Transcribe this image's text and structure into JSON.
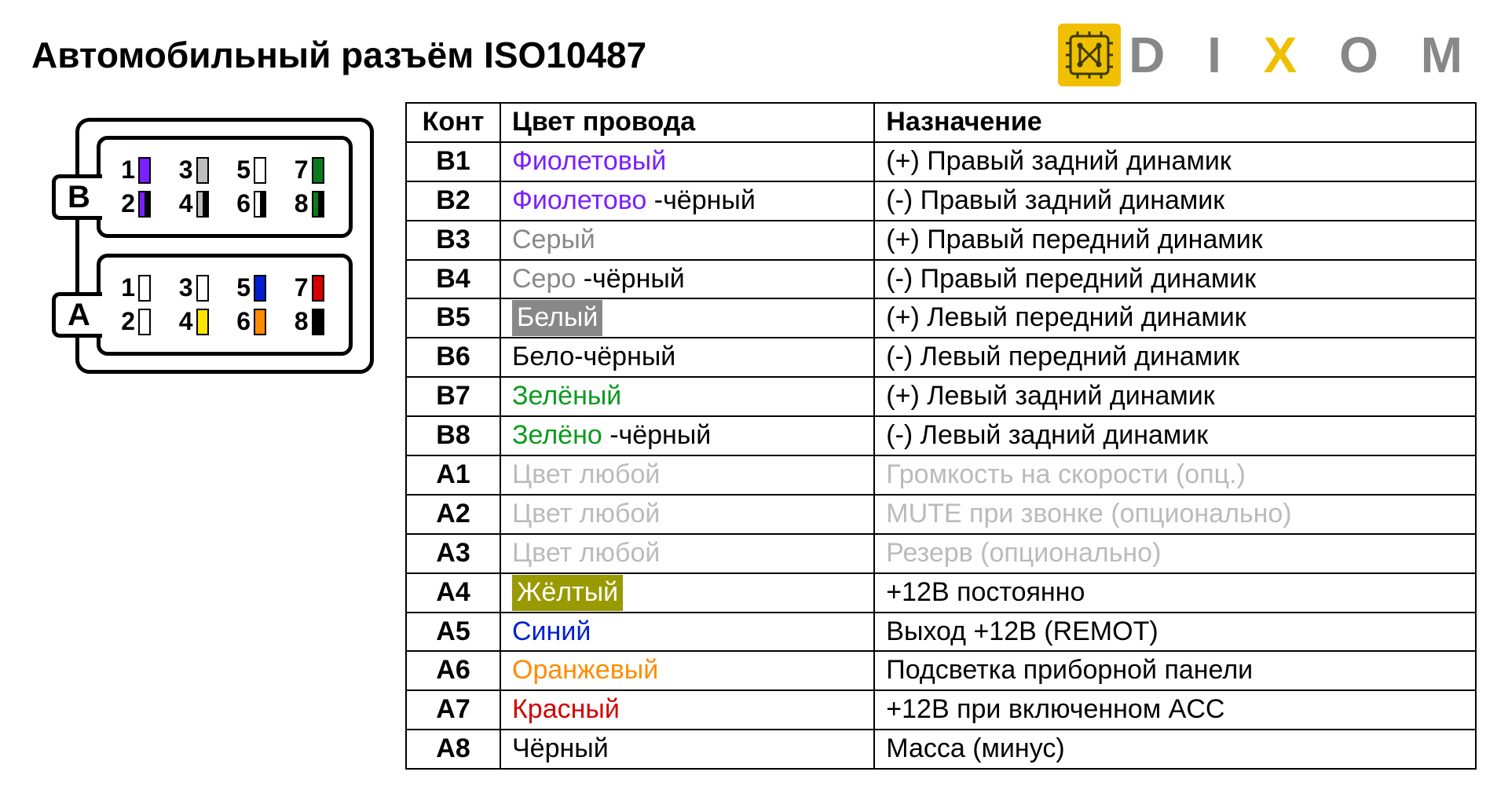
{
  "title": "Автомобильный разъём ISO10487",
  "brand": "DIXOM",
  "columns": {
    "pin": "Конт",
    "color": "Цвет провода",
    "function": "Назначение"
  },
  "connector": {
    "blocks": [
      {
        "name": "B",
        "rows": [
          [
            {
              "n": "1",
              "fill": "#7a1fff",
              "stripe": false
            },
            {
              "n": "3",
              "fill": "#bdbdbd",
              "stripe": false
            },
            {
              "n": "5",
              "fill": "#ffffff",
              "stripe": false
            },
            {
              "n": "7",
              "fill": "#0b7a1f",
              "stripe": false
            }
          ],
          [
            {
              "n": "2",
              "fill": "#7a1fff",
              "stripe": true
            },
            {
              "n": "4",
              "fill": "#bdbdbd",
              "stripe": true
            },
            {
              "n": "6",
              "fill": "#ffffff",
              "stripe": true
            },
            {
              "n": "8",
              "fill": "#0b7a1f",
              "stripe": true
            }
          ]
        ]
      },
      {
        "name": "A",
        "rows": [
          [
            {
              "n": "1",
              "fill": "#ffffff",
              "stripe": false
            },
            {
              "n": "3",
              "fill": "#ffffff",
              "stripe": false
            },
            {
              "n": "5",
              "fill": "#0020d0",
              "stripe": false
            },
            {
              "n": "7",
              "fill": "#d40000",
              "stripe": false
            }
          ],
          [
            {
              "n": "2",
              "fill": "#ffffff",
              "stripe": false
            },
            {
              "n": "4",
              "fill": "#ffe600",
              "stripe": false
            },
            {
              "n": "6",
              "fill": "#ff8c00",
              "stripe": false
            },
            {
              "n": "8",
              "fill": "#000000",
              "stripe": false
            }
          ]
        ]
      }
    ]
  },
  "pins": [
    {
      "pin": "B1",
      "color_parts": [
        {
          "t": "Фиолетовый",
          "c": "#7a1fff"
        }
      ],
      "func": "(+) Правый задний динамик",
      "func_c": "#000"
    },
    {
      "pin": "B2",
      "color_parts": [
        {
          "t": "Фиолетово ",
          "c": "#7a1fff"
        },
        {
          "t": "-чёрный",
          "c": "#000"
        }
      ],
      "func": "(-)  Правый задний динамик",
      "func_c": "#000"
    },
    {
      "pin": "B3",
      "color_parts": [
        {
          "t": "Серый",
          "c": "#888"
        }
      ],
      "func": "(+) Правый передний динамик",
      "func_c": "#000"
    },
    {
      "pin": "B4",
      "color_parts": [
        {
          "t": "Серо ",
          "c": "#888"
        },
        {
          "t": "-чёрный",
          "c": "#000"
        }
      ],
      "func": "(-)  Правый передний динамик",
      "func_c": "#000"
    },
    {
      "pin": "B5",
      "color_parts": [
        {
          "t": "Белый",
          "hl": "white"
        }
      ],
      "func": "(+) Левый передний динамик",
      "func_c": "#000"
    },
    {
      "pin": "B6",
      "color_parts": [
        {
          "t": "Бело",
          "c": "#000"
        },
        {
          "t": "-чёрный",
          "c": "#000"
        }
      ],
      "func": "(-)  Левый передний динамик",
      "func_c": "#000"
    },
    {
      "pin": "B7",
      "color_parts": [
        {
          "t": "Зелёный",
          "c": "#0b9a1f"
        }
      ],
      "func": "(+) Левый задний динамик",
      "func_c": "#000"
    },
    {
      "pin": "B8",
      "color_parts": [
        {
          "t": "Зелёно ",
          "c": "#0b9a1f"
        },
        {
          "t": "-чёрный",
          "c": "#000"
        }
      ],
      "func": "(-)  Левый задний динамик",
      "func_c": "#000"
    },
    {
      "pin": "A1",
      "color_parts": [
        {
          "t": "Цвет любой",
          "c": "#bbb"
        }
      ],
      "func": "Громкость на скорости (опц.)",
      "func_c": "#bbb"
    },
    {
      "pin": "A2",
      "color_parts": [
        {
          "t": "Цвет любой",
          "c": "#bbb"
        }
      ],
      "func": "MUTE при звонке (опционально)",
      "func_c": "#bbb"
    },
    {
      "pin": "A3",
      "color_parts": [
        {
          "t": "Цвет любой",
          "c": "#bbb"
        }
      ],
      "func": "Резерв (опционально)",
      "func_c": "#bbb"
    },
    {
      "pin": "A4",
      "color_parts": [
        {
          "t": "Жёлтый",
          "hl": "yellow"
        }
      ],
      "func": "+12В постоянно",
      "func_c": "#000"
    },
    {
      "pin": "A5",
      "color_parts": [
        {
          "t": "Синий",
          "c": "#0020d0"
        }
      ],
      "func": "Выход +12В (REMOT)",
      "func_c": "#000"
    },
    {
      "pin": "A6",
      "color_parts": [
        {
          "t": "Оранжевый",
          "c": "#ff8c00"
        }
      ],
      "func": "Подсветка приборной панели",
      "func_c": "#000"
    },
    {
      "pin": "A7",
      "color_parts": [
        {
          "t": "Красный",
          "c": "#d40000"
        }
      ],
      "func": "+12В при включенном ACC",
      "func_c": "#000"
    },
    {
      "pin": "A8",
      "color_parts": [
        {
          "t": "Чёрный",
          "c": "#000"
        }
      ],
      "func": "Масса (минус)",
      "func_c": "#000"
    }
  ]
}
